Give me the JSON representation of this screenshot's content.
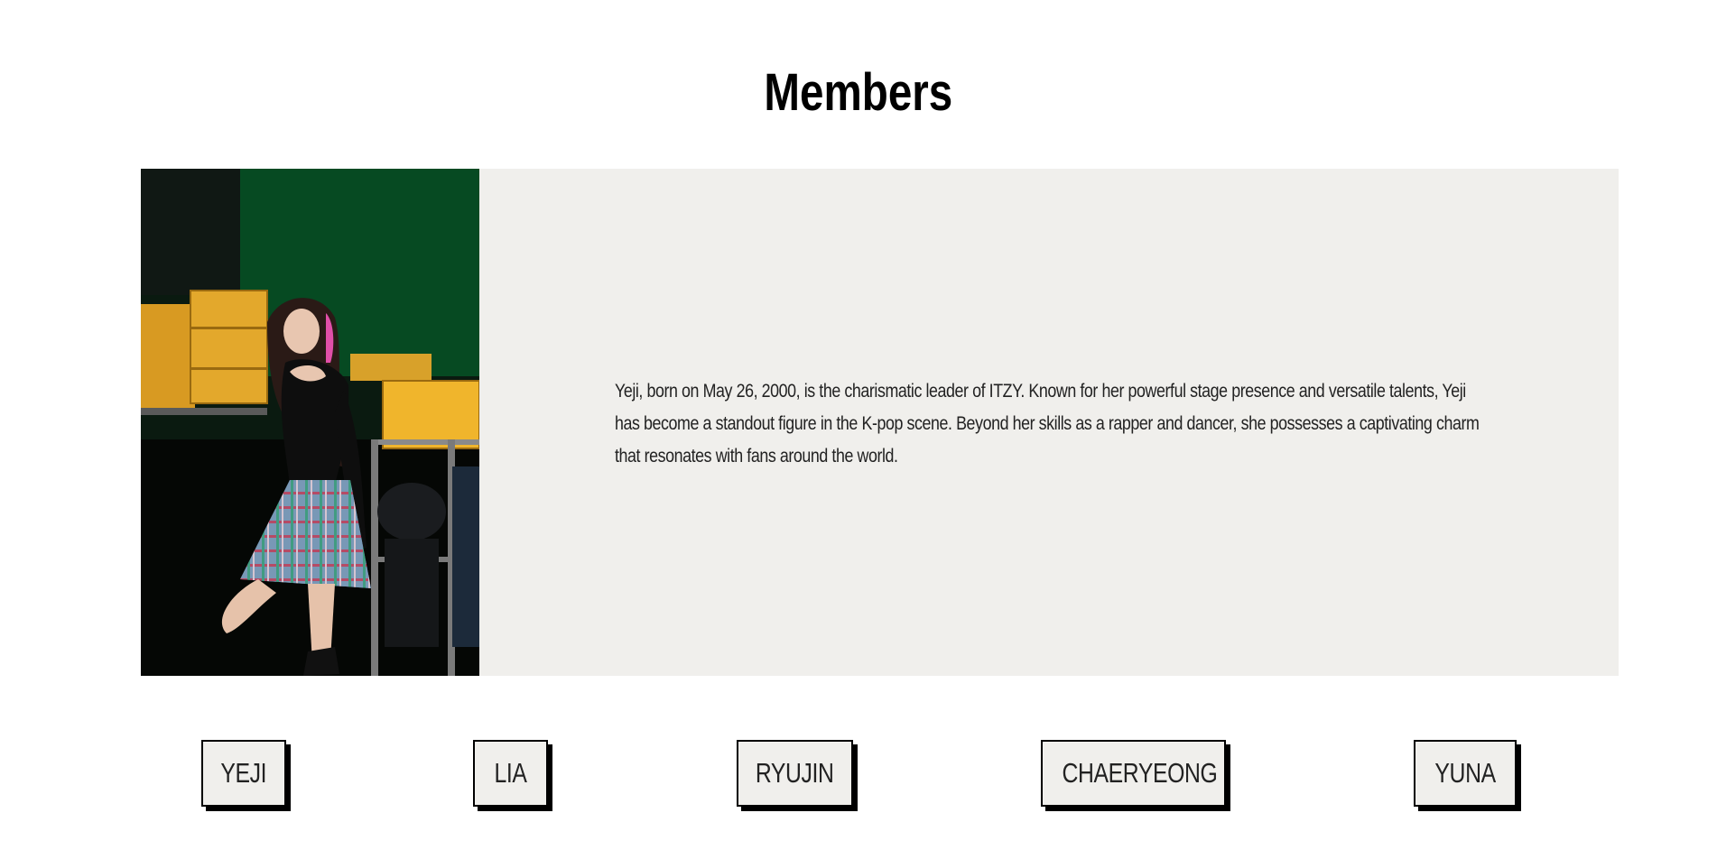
{
  "section": {
    "title": "Members"
  },
  "member": {
    "name": "YEJI",
    "bio": "Yeji, born on May 26, 2000, is the charismatic leader of ITZY. Known for her powerful stage presence and versatile talents, Yeji has become a standout figure in the K-pop scene. Beyond her skills as a rapper and dancer, she possesses a captivating charm that resonates with fans around the world."
  },
  "members_nav": [
    {
      "label": "YEJI"
    },
    {
      "label": "LIA"
    },
    {
      "label": "RYUJIN"
    },
    {
      "label": "CHAERYEONG"
    },
    {
      "label": "YUNA"
    }
  ],
  "colors": {
    "card_background": "#f0efec",
    "button_background": "#f0efec",
    "button_border": "#000000",
    "text": "#222222"
  }
}
